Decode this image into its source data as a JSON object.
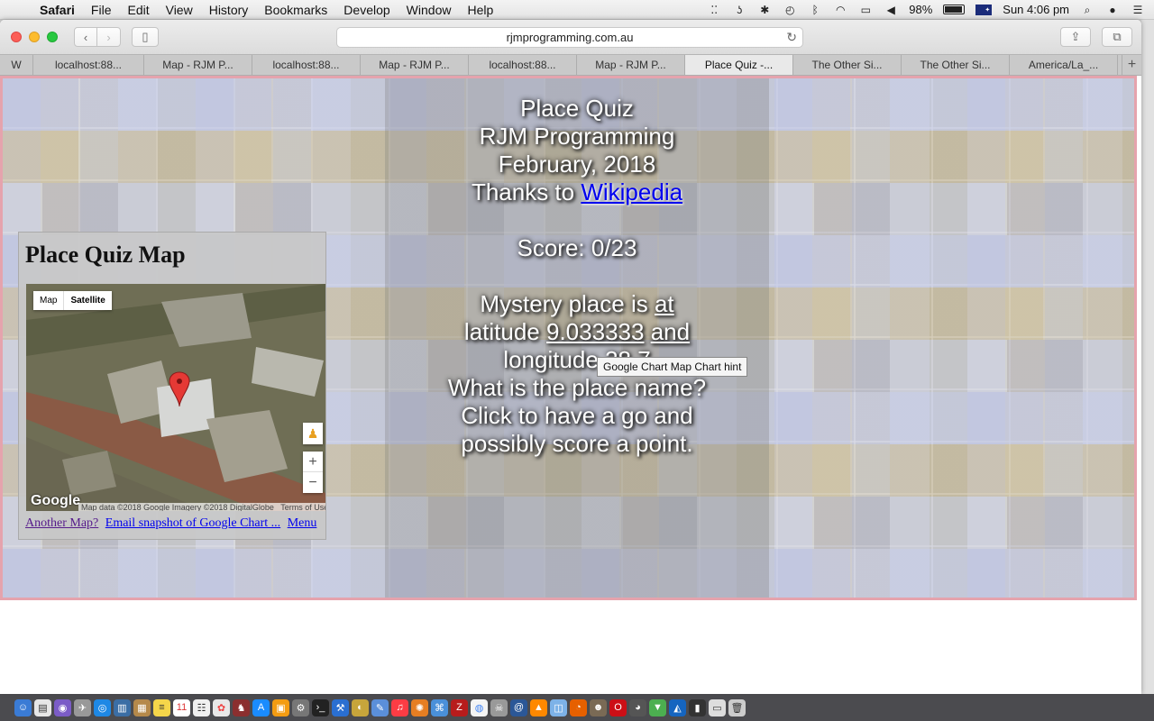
{
  "menubar": {
    "app_name": "Safari",
    "menus": [
      "File",
      "Edit",
      "View",
      "History",
      "Bookmarks",
      "Develop",
      "Window",
      "Help"
    ],
    "battery": "98%",
    "clock": "Sun 4:06 pm"
  },
  "browser": {
    "url": "rjmprogramming.com.au",
    "tabs": [
      {
        "label": "W",
        "width": 37
      },
      {
        "label": "localhost:88...",
        "width": 123
      },
      {
        "label": "Map - RJM P...",
        "width": 120
      },
      {
        "label": "localhost:88...",
        "width": 120
      },
      {
        "label": "Map - RJM P...",
        "width": 120
      },
      {
        "label": "localhost:88...",
        "width": 120
      },
      {
        "label": "Map - RJM P...",
        "width": 120
      },
      {
        "label": "Place Quiz -...",
        "width": 120,
        "active": true
      },
      {
        "label": "The Other Si...",
        "width": 120
      },
      {
        "label": "The Other Si...",
        "width": 120
      },
      {
        "label": "America/La_...",
        "width": 120
      }
    ]
  },
  "quiz": {
    "line1": "Place Quiz",
    "line2": "RJM Programming",
    "line3": "February, 2018",
    "thanks_prefix": "Thanks to",
    "thanks_link": "Wikipedia",
    "score": "Score: 0/23",
    "mystery_prefix": "Mystery place is",
    "mystery_at": "at",
    "lat_label": "latitude",
    "lat_value": "9.033333",
    "and_word": "and",
    "lon_label": "longitude",
    "lon_value": "38.7",
    "question": "What is the place name?",
    "prompt1": "Click to have a go and",
    "prompt2": "possibly score a point.",
    "tooltip": "Google Chart Map Chart hint"
  },
  "map_panel": {
    "title": "Place Quiz Map",
    "type_map": "Map",
    "type_satellite": "Satellite",
    "google_logo": "Google",
    "attribution": "Map data ©2018 Google Imagery ©2018 DigitalGlobe",
    "terms": "Terms of Use",
    "link_another": "Another Map?",
    "link_email": "Email snapshot of Google Chart ...",
    "link_menu": "Menu"
  },
  "dock": {
    "icons": [
      "finder-icon",
      "launchpad-icon",
      "siri-icon",
      "rocket-icon",
      "safari-icon",
      "book-icon",
      "contacts-icon",
      "notes-icon",
      "calendar-icon",
      "reminders-icon",
      "photos-icon",
      "chess-icon",
      "appstore-icon",
      "books-icon",
      "preferences-icon",
      "terminal-icon",
      "xcode-icon",
      "preview-icon",
      "music-icon",
      "photoshop-icon",
      "textedit-icon",
      "filezilla-icon",
      "chrome-icon",
      "mail-icon",
      "vlc-icon",
      "archive-icon",
      "firefox-icon",
      "gimp-icon",
      "opera-icon",
      "github-icon",
      "trash-icon"
    ]
  }
}
